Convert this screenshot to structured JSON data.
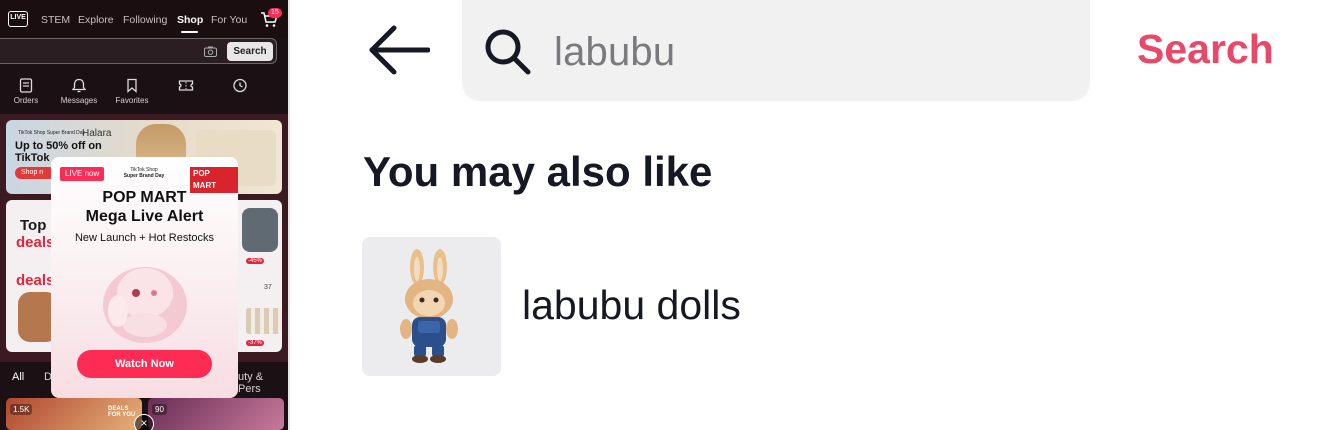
{
  "left_app": {
    "top_tabs": [
      "STEM",
      "Explore",
      "Following",
      "Shop",
      "For You"
    ],
    "active_tab": "Shop",
    "cart_badge": "15",
    "search_button": "Search",
    "shortcuts": [
      {
        "label": "Orders",
        "icon": "orders-icon"
      },
      {
        "label": "Messages",
        "icon": "bell-icon"
      },
      {
        "label": "Favorites",
        "icon": "bookmark-icon"
      },
      {
        "label": "",
        "icon": "ticket-icon"
      },
      {
        "label": "",
        "icon": "history-icon"
      }
    ],
    "banner1": {
      "badge": "TikTok Shop Super Brand Day",
      "brand": "Halara",
      "headline": "Up to 50% off on TikTok",
      "cta": "Shop n"
    },
    "banner2": {
      "top": "Top",
      "deals": "deals",
      "deals2": "deals",
      "tags": [
        "-45%",
        "-37%"
      ],
      "price": "37"
    },
    "categories": [
      "All",
      "D",
      "uty & Pers"
    ],
    "live_cards": [
      {
        "viewers": "1.5K",
        "deals": "DEALS FOR YOU"
      },
      {
        "viewers": "90"
      }
    ]
  },
  "popup": {
    "live_badge": "LIVE now",
    "sbd_line1": "TikTok Shop",
    "sbd_line2": "Super Brand Day",
    "brand": "POP MART",
    "title1": "POP MART",
    "title2": "Mega Live Alert",
    "subtitle": "New Launch + Hot Restocks",
    "watch_button": "Watch Now",
    "close": "×"
  },
  "search_page": {
    "query": "labubu",
    "search_button": "Search",
    "section_title": "You may also like",
    "suggestions": [
      {
        "text": "labubu dolls"
      }
    ]
  },
  "colors": {
    "accent_red": "#fe2c55",
    "search_action": "#e84869",
    "left_bg": "#1b1114"
  }
}
